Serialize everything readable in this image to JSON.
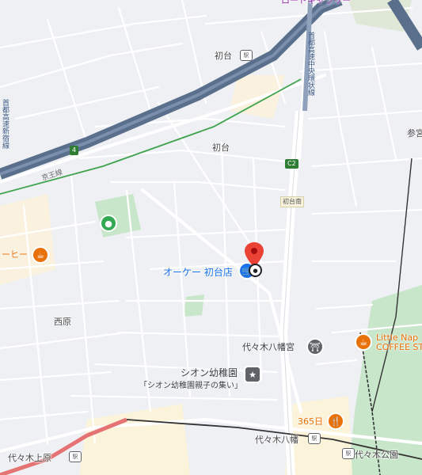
{
  "labels": {
    "top_poi": "ロードギャラリー",
    "hatsudai_station": "初台",
    "hatsudai_area": "初台",
    "nishihara": "西原",
    "okay_store": "オーケー 初台店",
    "coffee_left": "ーヒー",
    "shion_kindergarten": "シオン幼稚園",
    "shion_sub": "「シオン幼稚園親子の集い」",
    "yoyogi_hachimangu_shrine": "代々木八幡宮",
    "little_nap_1": "Little Nap",
    "little_nap_2": "COFFEE ST",
    "shop_365": "365日",
    "yoyogi_hachiman_station": "代々木八幡",
    "yoyogi_uehara": "代々木上原",
    "yoyogi_koen": "代々木公園",
    "sankuu": "参宮",
    "keio_line": "京王線",
    "shuto_road": "首都高速中央環状線",
    "shuto_road_left": "首都高速新宿線",
    "hatsudai_minami_sign": "初台南",
    "route_c2": "C2",
    "route_4": "4"
  },
  "colors": {
    "land": "#eef0f3",
    "street": "#ffffff",
    "highway": "#5a6f8c",
    "park": "#c8e6c9",
    "commercial": "#fdf3d8",
    "marker": "#ea4335",
    "blue_poi": "#1a73e8",
    "orange_poi": "#e8710a",
    "rail_red": "#e57373"
  },
  "icons": {
    "marker": "red-map-pin-icon",
    "store": "shopping-cart-icon",
    "coffee": "coffee-cup-icon",
    "restaurant": "fork-knife-icon",
    "shrine": "torii-icon",
    "school": "star-school-icon",
    "park": "park-tree-icon",
    "station": "train-station-icon"
  }
}
